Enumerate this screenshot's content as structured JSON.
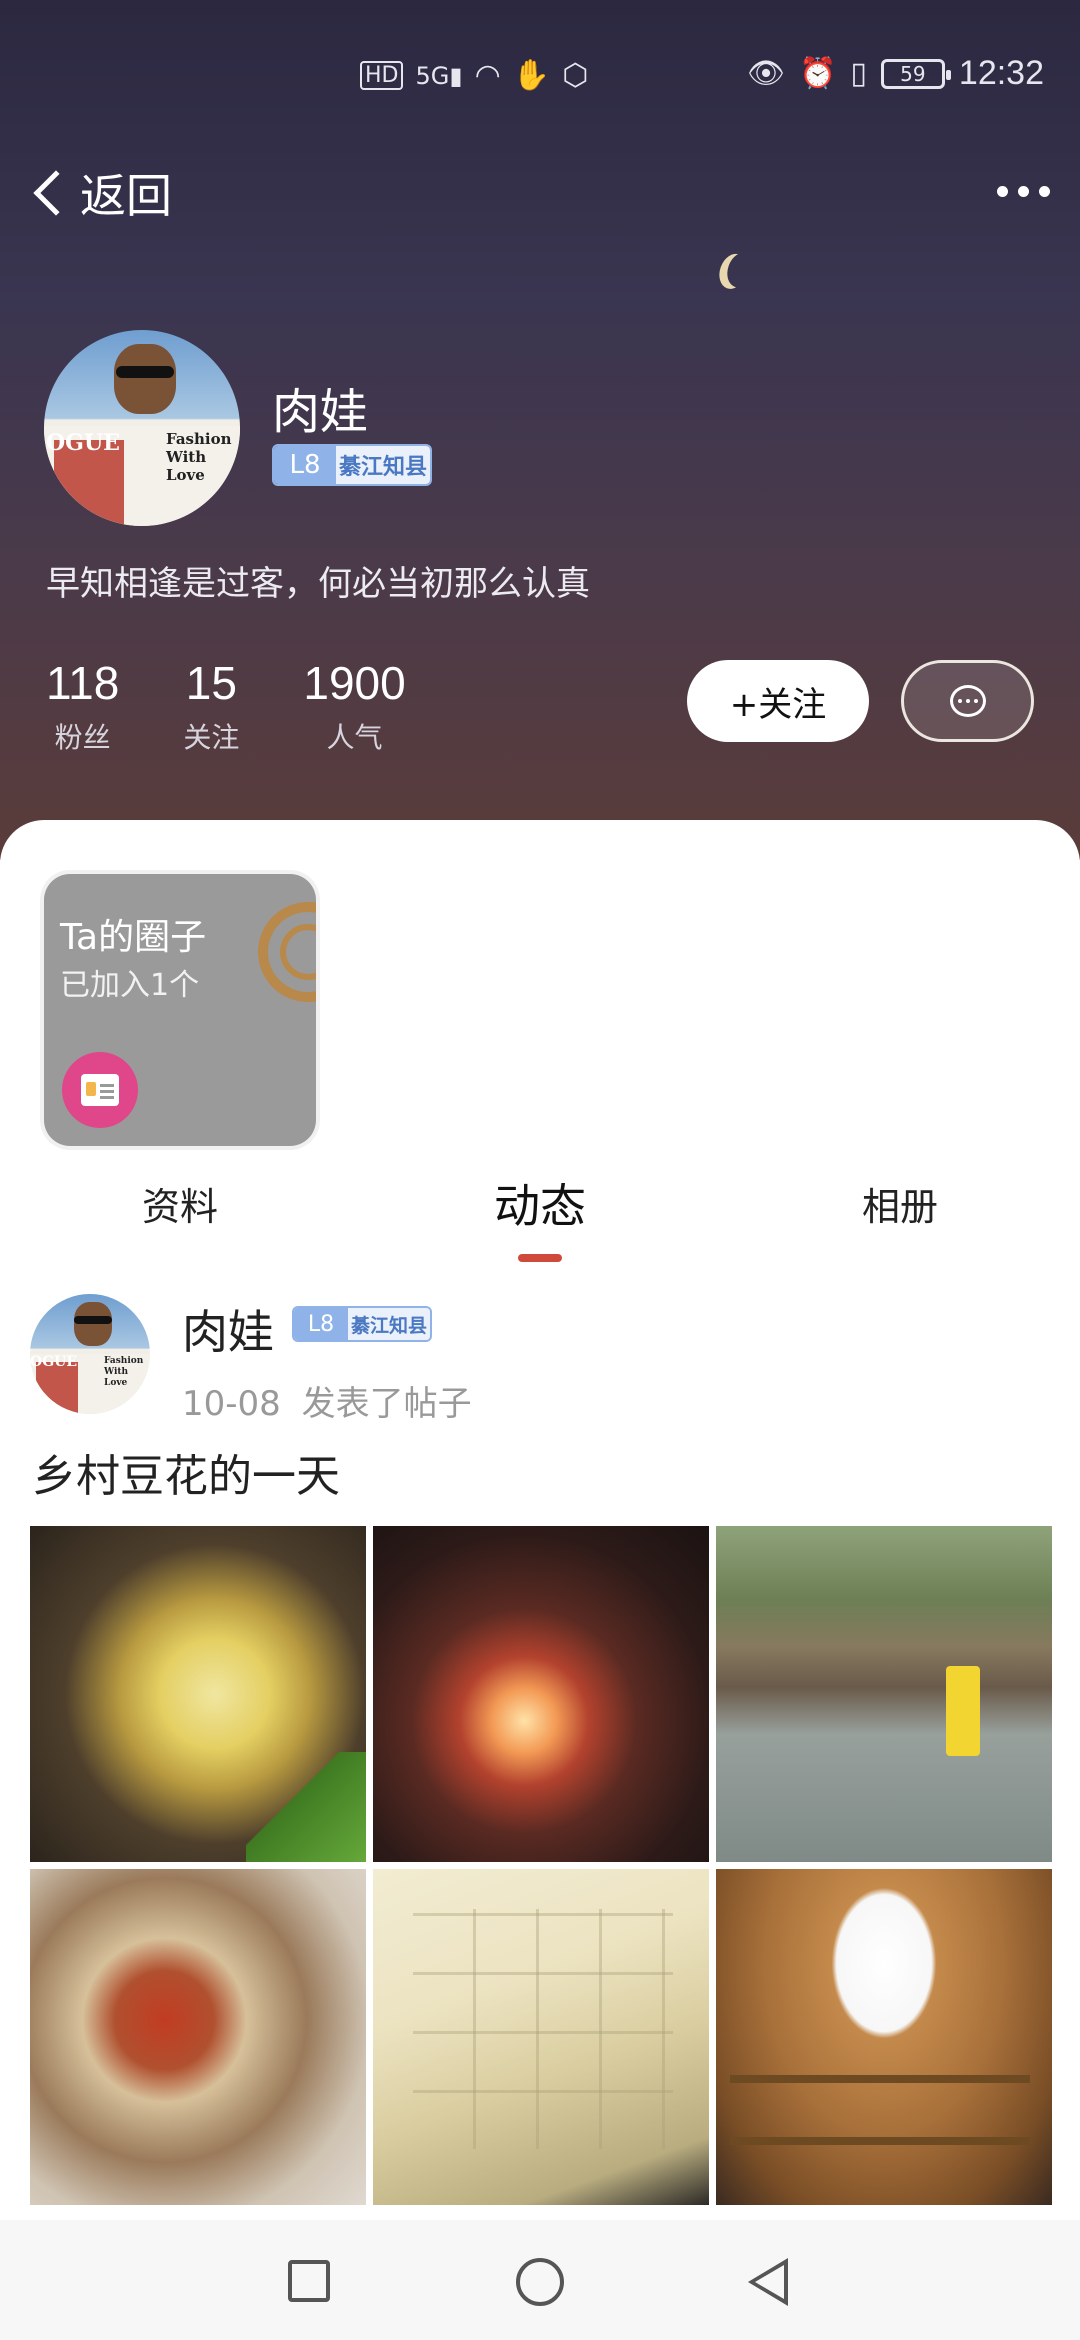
{
  "status_bar": {
    "left_icons": [
      "hd-icon",
      "signal-5g-icon",
      "wifi-icon",
      "hand-icon",
      "shield-icon"
    ],
    "right_icons": [
      "eye-icon",
      "alarm-icon",
      "vibrate-icon"
    ],
    "battery": "59",
    "time": "12:32"
  },
  "nav": {
    "back_label": "返回"
  },
  "profile": {
    "name": "肉娃",
    "level": "L8",
    "title": "綦江知县",
    "bio": "早知相逢是过客，何必当初那么认真",
    "avatar_text": "Fashion With Love",
    "avatar_mag": "OGUE",
    "stats": [
      {
        "value": "118",
        "label": "粉丝"
      },
      {
        "value": "15",
        "label": "关注"
      },
      {
        "value": "1900",
        "label": "人气"
      }
    ],
    "follow_label": "+关注"
  },
  "circle_card": {
    "title": "Ta的圈子",
    "subtitle": "已加入1个"
  },
  "tabs": [
    {
      "label": "资料",
      "active": false
    },
    {
      "label": "动态",
      "active": true
    },
    {
      "label": "相册",
      "active": false
    }
  ],
  "post": {
    "author": "肉娃",
    "level": "L8",
    "title_badge": "綦江知县",
    "date": "10-08",
    "action": "发表了帖子",
    "title": "乡村豆花的一天",
    "photos": [
      "sliced-bamboo-shoots",
      "wood-fire-stove",
      "people-in-field",
      "table-of-dishes",
      "tofu-in-pot",
      "wooden-rice-bucket"
    ]
  },
  "colors": {
    "accent": "#d04a3c",
    "level_badge": "#8fb2e8",
    "card_badge": "#e0468a"
  }
}
